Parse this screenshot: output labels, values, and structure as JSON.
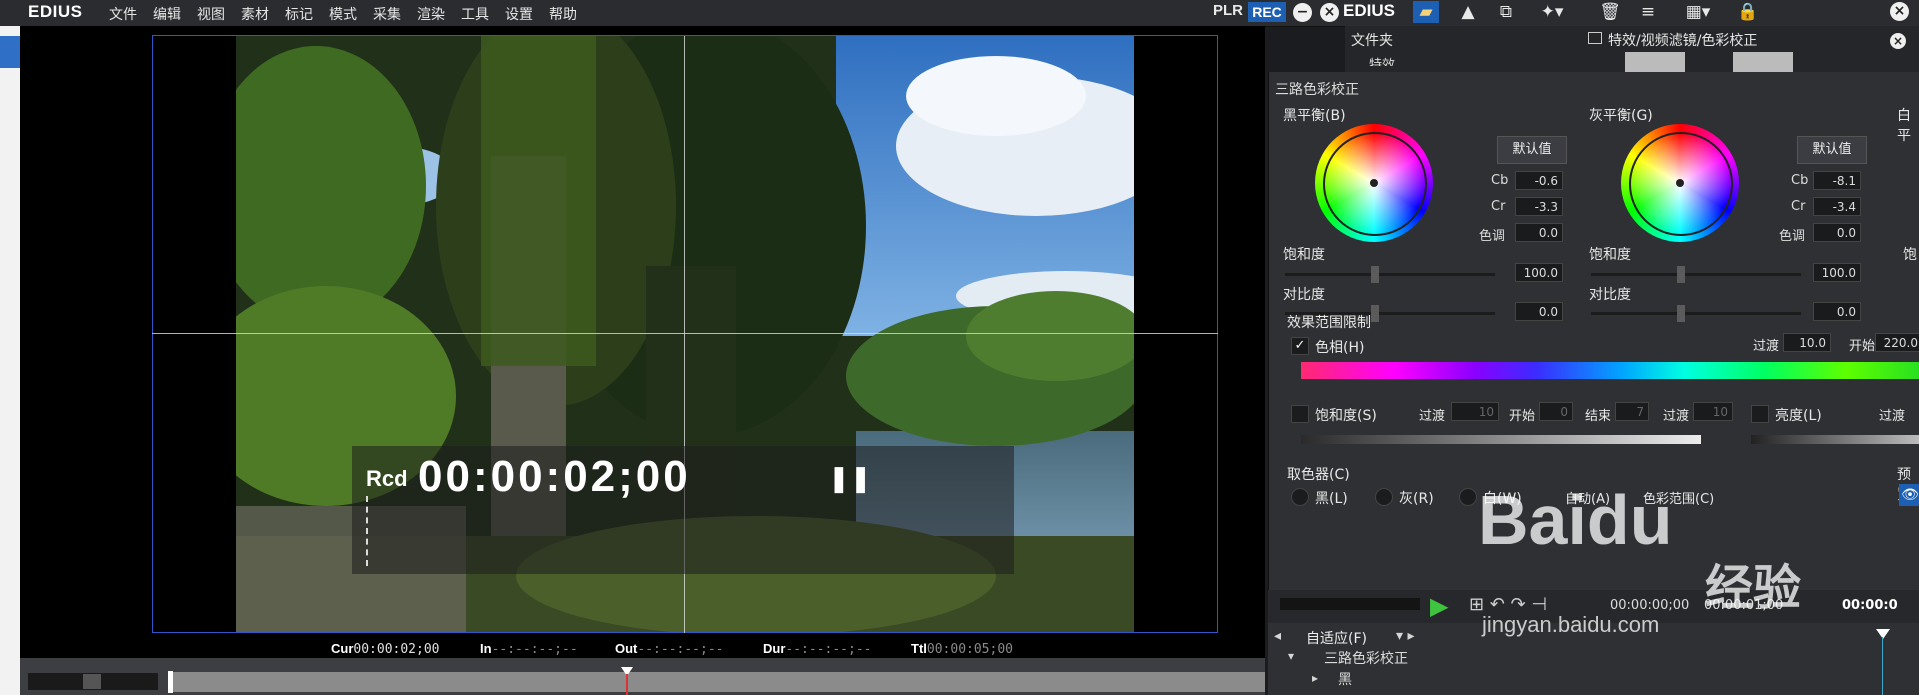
{
  "app": {
    "logo": "EDIUS",
    "menu": [
      "文件",
      "编辑",
      "视图",
      "素材",
      "标记",
      "模式",
      "采集",
      "渲染",
      "工具",
      "设置",
      "帮助"
    ],
    "plr_label": "PLR",
    "rec_label": "REC"
  },
  "player": {
    "overlay": {
      "mode": "Rcd",
      "timecode": "00:00:02;00",
      "state_icon": "pause-icon"
    },
    "status": {
      "cur_label": "Cur",
      "cur_value": "00:00:02;00",
      "in_label": "In",
      "in_value": "--:--:--;--",
      "out_label": "Out",
      "out_value": "--:--:--;--",
      "dur_label": "Dur",
      "dur_value": "--:--:--;--",
      "ttl_label": "Ttl",
      "ttl_value": "00:00:05;00"
    },
    "scrub_position": 0.4
  },
  "right_toolbar": {
    "logo": "EDIUS",
    "icons": [
      "folder-icon",
      "triangle-icon",
      "network-icon",
      "add-effect-icon",
      "trash-icon",
      "list-icon",
      "grid-icon",
      "lock-icon"
    ]
  },
  "bin": {
    "folder_label": "文件夹",
    "path": "特效/视频滤镜/色彩校正",
    "tree_item": "特效"
  },
  "effect": {
    "title": "三路色彩校正",
    "black": {
      "label": "黑平衡(B)",
      "default_btn": "默认值",
      "cb_label": "Cb",
      "cb": "-0.6",
      "cr_label": "Cr",
      "cr": "-3.3",
      "hue_label": "色调",
      "hue": "0.0",
      "sat_label": "饱和度",
      "sat": "100.0",
      "contrast_label": "对比度",
      "contrast": "0.0"
    },
    "gray": {
      "label": "灰平衡(G)",
      "default_btn": "默认值",
      "cb_label": "Cb",
      "cb": "-8.1",
      "cr_label": "Cr",
      "cr": "-3.4",
      "hue_label": "色调",
      "hue": "0.0",
      "sat_label": "饱和度",
      "sat": "100.0",
      "contrast_label": "对比度",
      "contrast": "0.0"
    },
    "white_partial": "白平",
    "white_sat_partial": "饱",
    "range": {
      "label": "效果范围限制",
      "hue_check": "✓",
      "hue_label": "色相(H)",
      "fade_label": "过渡",
      "fade_value": "10.0",
      "start_label": "开始",
      "start_value": "220.0",
      "sat_label": "饱和度(S)",
      "sat_fade_label": "过渡",
      "sat_fade_value": "10",
      "sat_start_label": "开始",
      "sat_start_value": "0",
      "sat_end_label": "结束",
      "sat_end_value": "7",
      "sat_fade2_label": "过渡",
      "sat_fade2_value": "10",
      "lum_label": "亮度(L)",
      "lum_fade_label": "过渡"
    },
    "picker": {
      "label": "取色器(C)",
      "black": "黑(L)",
      "gray": "灰(R)",
      "white": "白(W)",
      "auto": "自动(A)",
      "range": "色彩范围(C)",
      "preview_partial": "预览"
    }
  },
  "timeline": {
    "fit_label": "自适应(F)",
    "times": [
      "00:00:00;00",
      "00:00:01;00",
      "00:00:0"
    ],
    "rows": [
      "三路色彩校正",
      "黑"
    ]
  },
  "watermark": {
    "brand": "Baidu",
    "cn": "经验",
    "url": "jingyan.baidu.com"
  }
}
